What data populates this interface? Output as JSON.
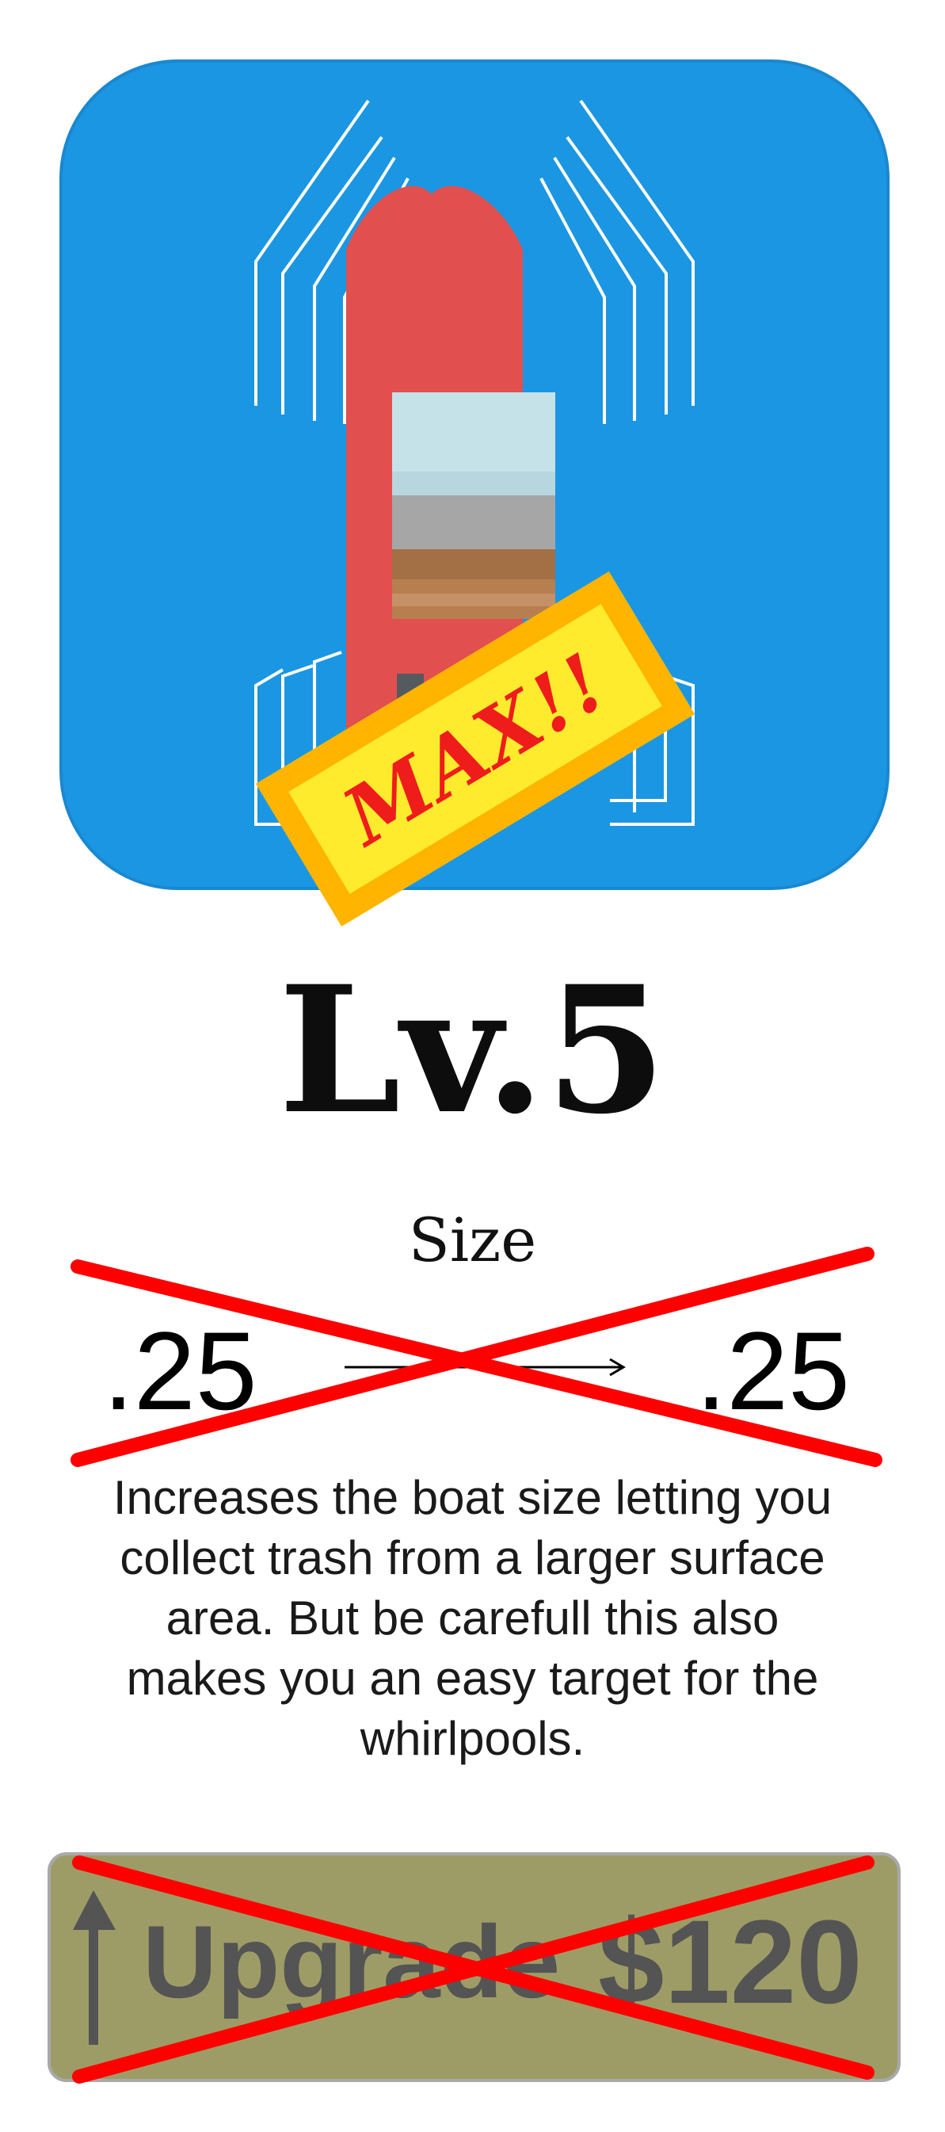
{
  "upgrade_card": {
    "level_label": "Lv.5",
    "max_badge": "MAX!!",
    "stat": {
      "name": "Size",
      "current_value": ".25",
      "next_value": ".25"
    },
    "description": "Increases the boat size letting you collect trash from a larger surface area. But be carefull this also makes you an easy target for the whirlpools.",
    "upgrade_button": {
      "label": "Upgrade",
      "price": "$120",
      "disabled": true
    }
  },
  "icons": {
    "main": "boat-icon",
    "badge": "max-badge",
    "arrow": "right-arrow-icon",
    "upgrade": "up-arrow-icon",
    "disabled_mark": "red-x-mark"
  },
  "colors": {
    "icon_bg": "#1b96e2",
    "boat_hull": "#e24f4f",
    "badge_fill": "#ffeb2e",
    "badge_border": "#ffb400",
    "badge_text": "#ef1c1c",
    "cross": "#ff0000",
    "button_bg": "#9e9c66",
    "button_text": "#545454"
  }
}
